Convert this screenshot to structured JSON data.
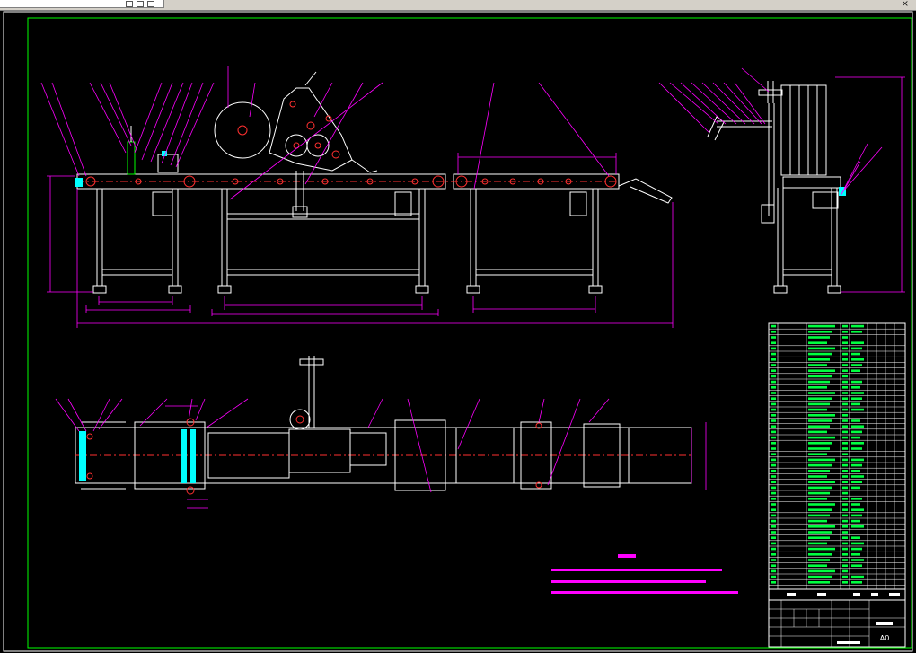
{
  "window": {
    "close_glyph": "×"
  },
  "colors": {
    "background": "#000000",
    "frame": "#00ff00",
    "magenta": "#ff00ff",
    "white": "#ffffff",
    "red": "#ff3030",
    "cyan": "#00ffff",
    "yellow": "#ffff00",
    "table_text": "#00ff40"
  },
  "title_block": {
    "sheet_size": "A0"
  }
}
